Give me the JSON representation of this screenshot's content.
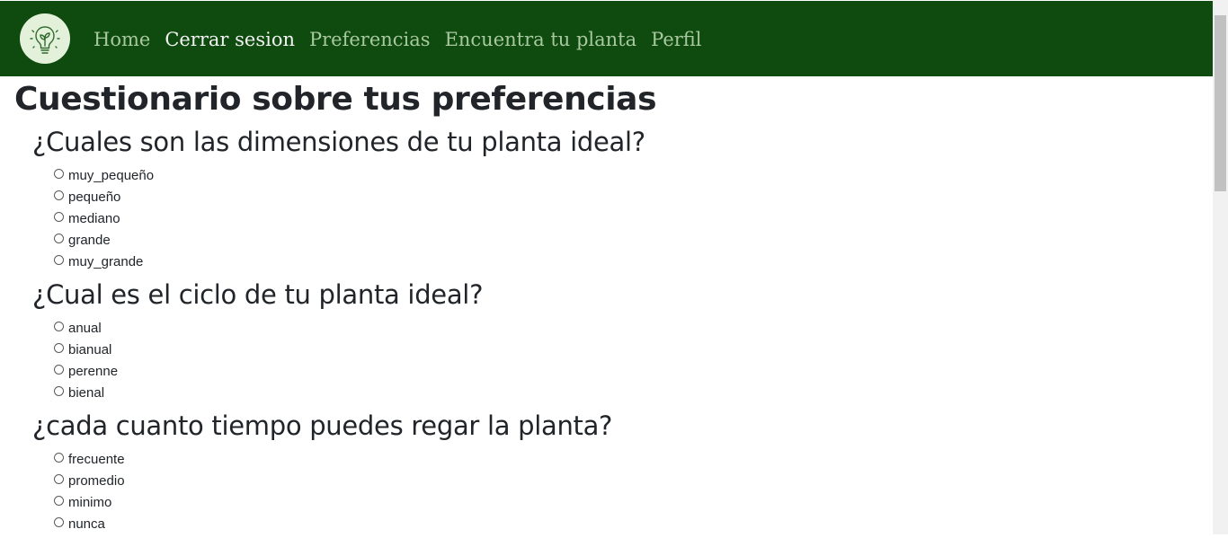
{
  "navbar": {
    "logo_icon": "plant-lightbulb-icon",
    "links": [
      {
        "label": "Home",
        "active": false
      },
      {
        "label": "Cerrar sesion",
        "active": true
      },
      {
        "label": "Preferencias",
        "active": false
      },
      {
        "label": "Encuentra tu planta",
        "active": false
      },
      {
        "label": "Perfil",
        "active": false
      }
    ],
    "colors": {
      "background": "#0f4a0f",
      "link": "#a8c8a0",
      "active_link": "#f2f2f2"
    }
  },
  "page": {
    "title": "Cuestionario sobre tus preferencias"
  },
  "questions": [
    {
      "title": "¿Cuales son las dimensiones de tu planta ideal?",
      "options": [
        "muy_pequeño",
        "pequeño",
        "mediano",
        "grande",
        "muy_grande"
      ]
    },
    {
      "title": "¿Cual es el ciclo de tu planta ideal?",
      "options": [
        "anual",
        "bianual",
        "perenne",
        "bienal"
      ]
    },
    {
      "title": "¿cada cuanto tiempo puedes regar la planta?",
      "options": [
        "frecuente",
        "promedio",
        "minimo",
        "nunca"
      ]
    }
  ]
}
